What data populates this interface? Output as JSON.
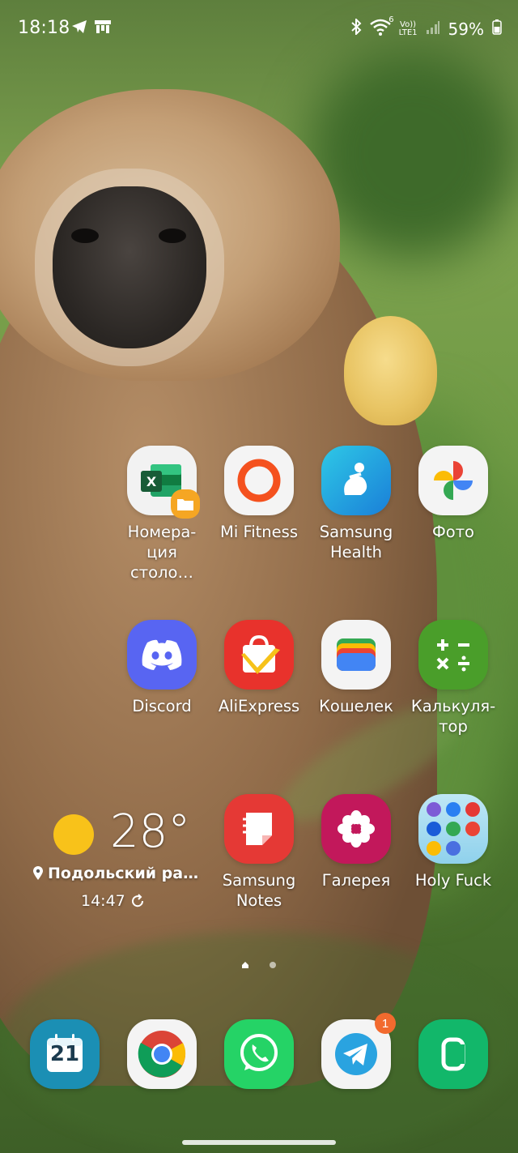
{
  "status_bar": {
    "time": "18:18",
    "left_icons": [
      "telegram-icon",
      "app-notification-icon"
    ],
    "right_icons": [
      "bluetooth-icon",
      "wifi-icon",
      "volte-icon",
      "signal-icon"
    ],
    "network_label_top": "Vo))",
    "network_label_bottom": "LTE1",
    "wifi_label": "6",
    "battery": "59%"
  },
  "apps": [
    {
      "label": "Номера-ция столо…",
      "icon": "excel-files-icon"
    },
    {
      "label": "Mi Fitness",
      "icon": "mi-fitness-icon"
    },
    {
      "label": "Samsung Health",
      "icon": "samsung-health-icon"
    },
    {
      "label": "Фото",
      "icon": "google-photos-icon"
    },
    {
      "label": "Discord",
      "icon": "discord-icon"
    },
    {
      "label": "AliExpress",
      "icon": "aliexpress-icon"
    },
    {
      "label": "Кошелек",
      "icon": "wallet-icon"
    },
    {
      "label": "Калькуля-тор",
      "icon": "calculator-icon"
    },
    {
      "label": "Samsung Notes",
      "icon": "samsung-notes-icon"
    },
    {
      "label": "Галерея",
      "icon": "gallery-icon"
    },
    {
      "label": "Holy Fuck",
      "icon": "folder-icon"
    }
  ],
  "weather": {
    "temperature": "28°",
    "location": "Подольский ра…",
    "updated": "14:47"
  },
  "dock": [
    {
      "icon": "calendar-icon",
      "text": "21"
    },
    {
      "icon": "chrome-icon"
    },
    {
      "icon": "whatsapp-icon"
    },
    {
      "icon": "telegram-icon",
      "badge": "1"
    },
    {
      "icon": "phone-icon"
    }
  ],
  "pages": {
    "current": 1,
    "total": 2
  },
  "colors": {
    "excel_green": "#1d7a45",
    "mi_orange": "#f4511e",
    "health_blue": "#1a9fd8",
    "discord_blurple": "#5865f2",
    "ali_red": "#e8322c",
    "calc_green": "#4a9e2a",
    "notes_red": "#e53935",
    "gallery_pink": "#c2185b",
    "whatsapp_green": "#25d366",
    "telegram_blue": "#2aa3e0",
    "phone_green": "#12b76a",
    "calendar_blue": "#1b8fb4"
  }
}
